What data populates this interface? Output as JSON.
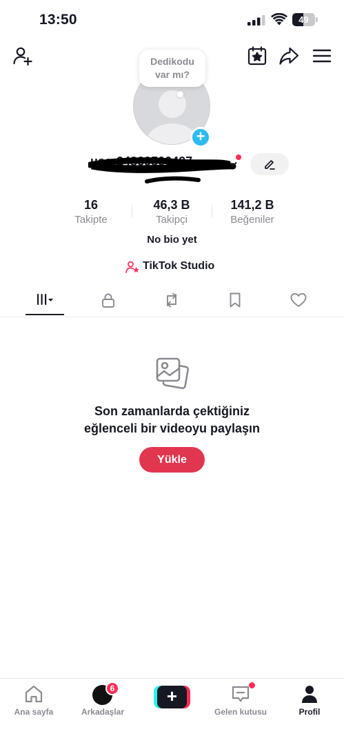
{
  "status_bar": {
    "time": "13:50",
    "battery_level": "49",
    "battery_fraction": 0.49
  },
  "toolbar": {
    "left_icon": "add-user-icon",
    "right_icons": [
      "calendar-star-icon",
      "share-arrow-icon",
      "menu-icon"
    ]
  },
  "bubble": {
    "line1": "Dedikodu",
    "line2": "var mı?"
  },
  "profile": {
    "username": "user24869500427",
    "username_redacted": true
  },
  "stats": [
    {
      "value": "16",
      "label": "Takipte"
    },
    {
      "value": "46,3 B",
      "label": "Takipçi"
    },
    {
      "value": "141,2 B",
      "label": "Beğeniler"
    }
  ],
  "bio": "No bio yet",
  "studio": {
    "label": "TikTok Studio",
    "icon": "studio-user-star-icon"
  },
  "tabs": [
    {
      "name": "videos-grid",
      "icon": "grid-bars-icon",
      "active": true
    },
    {
      "name": "private",
      "icon": "lock-icon",
      "active": false
    },
    {
      "name": "reposts",
      "icon": "repost-icon",
      "active": false
    },
    {
      "name": "favorites",
      "icon": "bookmark-icon",
      "active": false
    },
    {
      "name": "liked",
      "icon": "heart-icon",
      "active": false
    }
  ],
  "empty_state": {
    "icon": "photos-icon",
    "line1": "Son zamanlarda çektiğiniz",
    "line2": "eğlenceli bir videoyu paylaşın",
    "button_label": "Yükle"
  },
  "bottom_nav": {
    "home_label": "Ana sayfa",
    "friends_label": "Arkadaşlar",
    "friends_badge": "6",
    "inbox_label": "Gelen kutusu",
    "profile_label": "Profil"
  },
  "colors": {
    "accent_red": "#fe2c55",
    "upload_button": "#e13650",
    "avatar_add": "#2dbaf0",
    "text_primary": "#161823",
    "text_secondary": "#8a8b91"
  }
}
